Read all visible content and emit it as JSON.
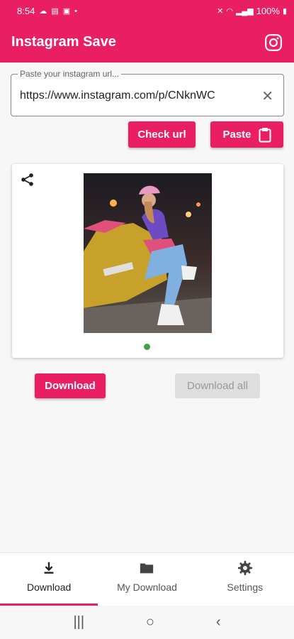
{
  "status_bar": {
    "time": "8:54",
    "battery": "100%",
    "left_icons": [
      "cloud-icon",
      "signal-badge-icon",
      "image-icon",
      "dot-icon"
    ],
    "right_icons": [
      "mute-icon",
      "wifi-icon",
      "signal-icon",
      "battery-icon"
    ]
  },
  "app_bar": {
    "title": "Instagram Save",
    "icon": "instagram-icon"
  },
  "url_field": {
    "label": "Paste your instagram url...",
    "value": "https://www.instagram.com/p/CNknWC",
    "clear_icon": "close-icon"
  },
  "actions": {
    "check_url": "Check url",
    "paste": "Paste",
    "paste_icon": "clipboard-icon"
  },
  "preview": {
    "share_icon": "share-icon",
    "dot_color": "#43a047"
  },
  "download": {
    "download_label": "Download",
    "download_all_label": "Download all"
  },
  "bottom_nav": {
    "items": [
      {
        "label": "Download",
        "icon": "download-icon",
        "active": true
      },
      {
        "label": "My Download",
        "icon": "folder-icon",
        "active": false
      },
      {
        "label": "Settings",
        "icon": "gear-icon",
        "active": false
      }
    ]
  },
  "system_nav": {
    "recents": "|||",
    "home": "○",
    "back": "‹"
  },
  "colors": {
    "accent": "#e91e63",
    "disabled_bg": "#dedede",
    "disabled_text": "#9a9a9a"
  }
}
